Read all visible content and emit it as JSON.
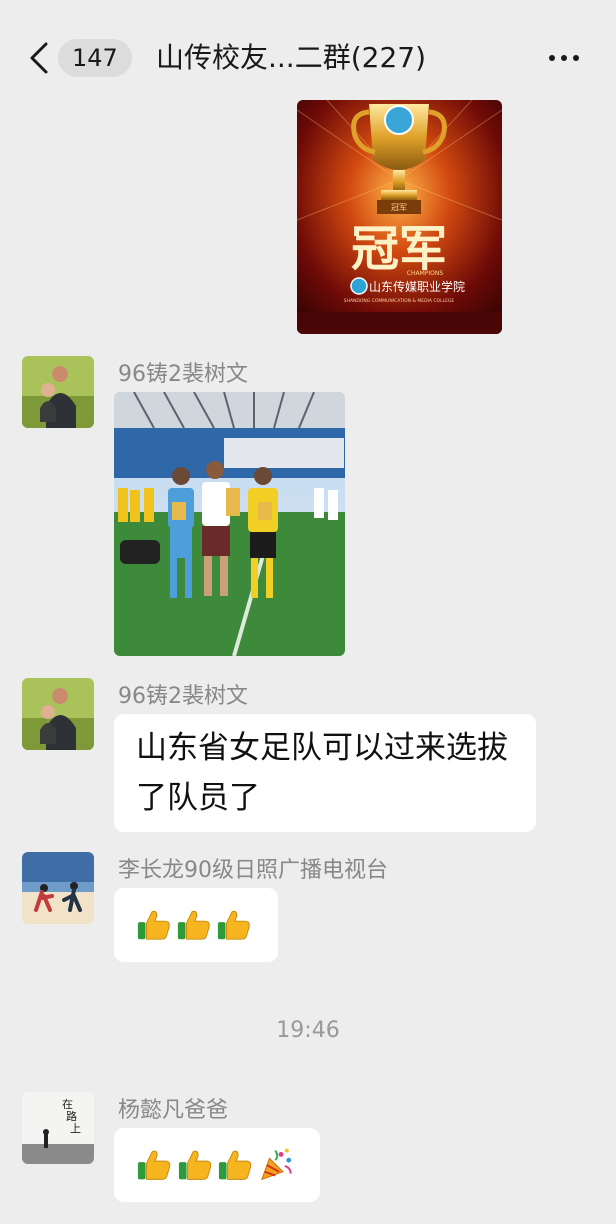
{
  "header": {
    "unread_count": "147",
    "title": "山传校友...二群(227)"
  },
  "messages": [
    {
      "type": "image",
      "image": {
        "title": "冠军",
        "subtitle": "CHAMPIONS",
        "school": "山东传媒职业学院",
        "school_en": "SHANDONG COMMUNICATION & MEDIA COLLEGE",
        "badge": "冠军"
      }
    },
    {
      "type": "image",
      "sender": "96铸2裴树文"
    },
    {
      "type": "text",
      "sender": "96铸2裴树文",
      "text": "山东省女足队可以过来选拔了队员了"
    },
    {
      "type": "emoji",
      "sender": "李长龙90级日照广播电视台",
      "emojis": [
        "thumbs-up",
        "thumbs-up",
        "thumbs-up"
      ]
    }
  ],
  "timestamp": "19:46",
  "messages_after": [
    {
      "type": "emoji",
      "sender": "杨懿凡爸爸",
      "emojis": [
        "thumbs-up",
        "thumbs-up",
        "thumbs-up",
        "party-popper"
      ]
    }
  ],
  "avatar_captions": {
    "road": "在路上"
  },
  "colors": {
    "background": "#ededed",
    "bubble": "#ffffff",
    "sender": "#888888"
  }
}
